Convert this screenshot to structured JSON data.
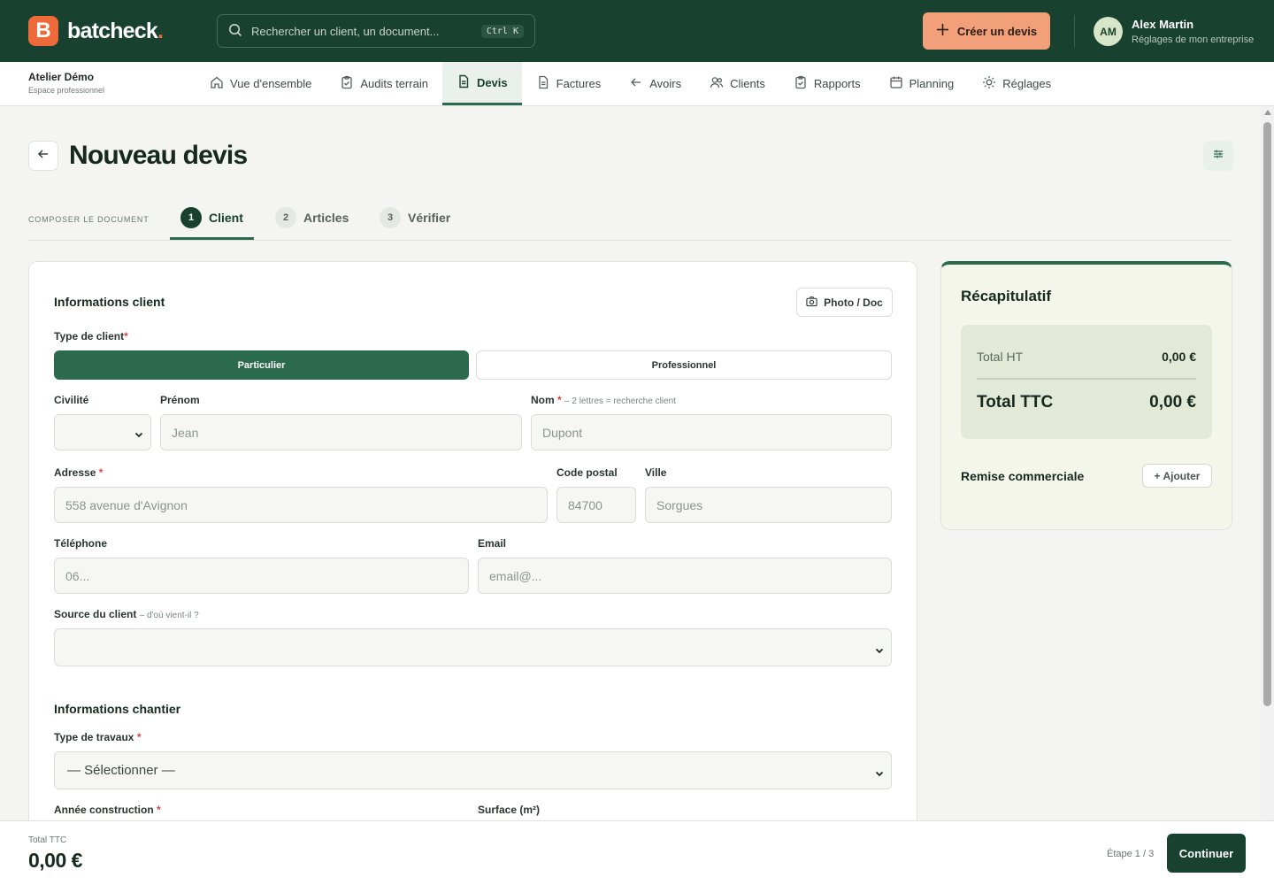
{
  "brand": {
    "mark": "B",
    "name": "batcheck",
    "dot": "."
  },
  "search": {
    "placeholder": "Rechercher un client, un document...",
    "shortcut": "Ctrl K"
  },
  "header": {
    "create_label": "Créer un devis"
  },
  "user": {
    "initials": "AM",
    "name": "Alex Martin",
    "subtitle": "Réglages de mon entreprise"
  },
  "workspace": {
    "name": "Atelier Démo",
    "subtitle": "Espace professionnel"
  },
  "nav": {
    "tabs": [
      {
        "label": "Vue d'ensemble",
        "icon": "home-icon"
      },
      {
        "label": "Audits terrain",
        "icon": "clipboard-check-icon"
      },
      {
        "label": "Devis",
        "icon": "document-icon",
        "active": true
      },
      {
        "label": "Factures",
        "icon": "file-icon"
      },
      {
        "label": "Avoirs",
        "icon": "arrow-left-icon"
      },
      {
        "label": "Clients",
        "icon": "users-icon"
      },
      {
        "label": "Rapports",
        "icon": "clipboard-icon"
      },
      {
        "label": "Planning",
        "icon": "calendar-icon"
      },
      {
        "label": "Réglages",
        "icon": "sun-gear-icon"
      }
    ]
  },
  "page": {
    "title": "Nouveau devis"
  },
  "stepper": {
    "caption": "COMPOSER LE DOCUMENT",
    "steps": [
      {
        "num": "1",
        "label": "Client",
        "active": true
      },
      {
        "num": "2",
        "label": "Articles"
      },
      {
        "num": "3",
        "label": "Vérifier"
      }
    ]
  },
  "form": {
    "client_section": "Informations client",
    "photo_button": "Photo / Doc",
    "client_type": {
      "label": "Type de client",
      "options": [
        "Particulier",
        "Professionnel"
      ],
      "selected": "Particulier"
    },
    "civilite": {
      "label": "Civilité",
      "value": ""
    },
    "prenom": {
      "label": "Prénom",
      "placeholder": "Jean"
    },
    "nom": {
      "label": "Nom",
      "hint": "– 2 lettres = recherche client",
      "placeholder": "Dupont"
    },
    "adresse": {
      "label": "Adresse",
      "placeholder": "558 avenue d'Avignon"
    },
    "code_postal": {
      "label": "Code postal",
      "placeholder": "84700"
    },
    "ville": {
      "label": "Ville",
      "placeholder": "Sorgues"
    },
    "telephone": {
      "label": "Téléphone",
      "placeholder": "06..."
    },
    "email": {
      "label": "Email",
      "placeholder": "email@..."
    },
    "source": {
      "label": "Source du client",
      "hint": "– d'où vient-il ?",
      "value": ""
    },
    "chantier_section": "Informations chantier",
    "type_travaux": {
      "label": "Type de travaux",
      "value": "— Sélectionner —"
    },
    "annee": {
      "label": "Année construction"
    },
    "surface": {
      "label": "Surface (m²)"
    }
  },
  "summary": {
    "title": "Récapitulatif",
    "total_ht_label": "Total HT",
    "total_ht": "0,00 €",
    "total_ttc_label": "Total TTC",
    "total_ttc": "0,00 €",
    "remise_label": "Remise commerciale",
    "add_label": "+ Ajouter"
  },
  "footer": {
    "total_label": "Total TTC",
    "total": "0,00 €",
    "step": "Étape 1 / 3",
    "continue_label": "Continuer"
  },
  "colors": {
    "primary": "#19412f",
    "accent": "#f2a07a",
    "brand_orange": "#ef6a3a",
    "required": "#d64545"
  }
}
